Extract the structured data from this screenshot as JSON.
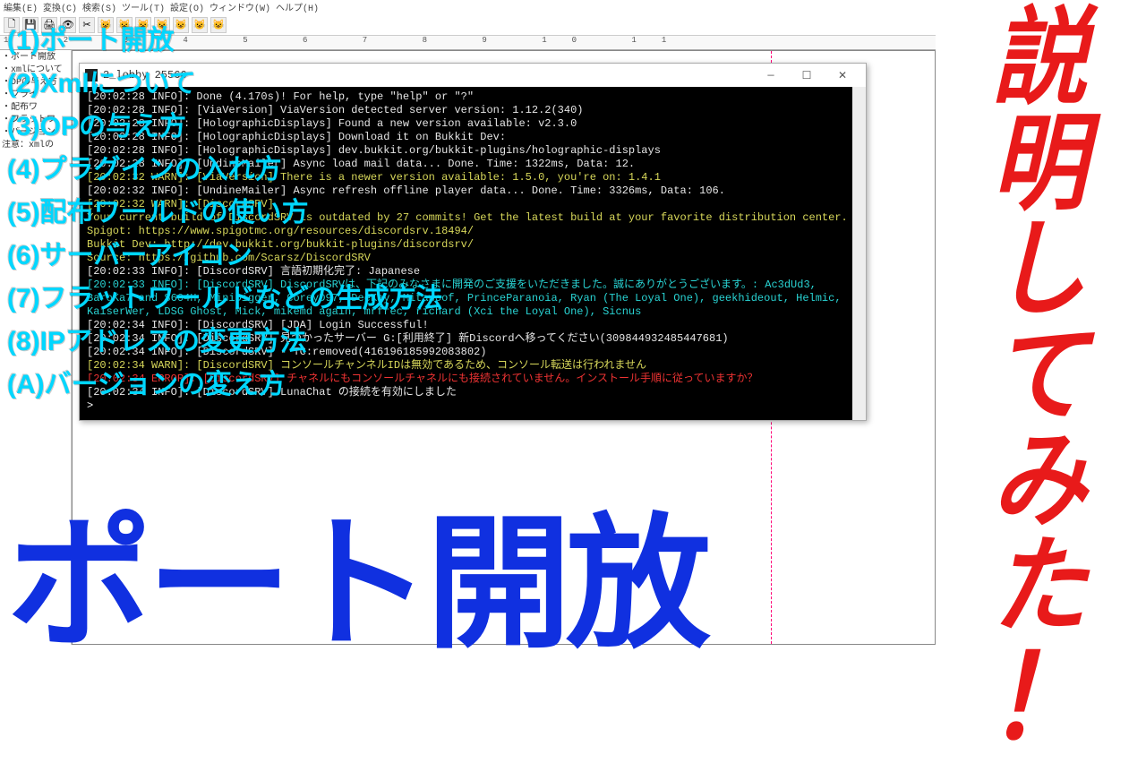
{
  "editor": {
    "menubar": "編集(E)  変換(C)  検索(S)  ツール(T)  設定(O)  ウィンドウ(W)  ヘルプ(H)",
    "ruler": "1 2 3 4 5 6 7 8 9 10 11",
    "outline": [
      "・ポート開放",
      "・xmlについて",
      "・OPの与え方",
      "・プライ",
      "・配布ワ",
      "・フラットワ",
      "・バージョン",
      "注意：xmlの"
    ]
  },
  "console": {
    "title": "2_lobby 25566",
    "lines": [
      {
        "cls": "c-white",
        "text": "[20:02:28 INFO]: Done (4.170s)! For help, type \"help\" or \"?\""
      },
      {
        "cls": "c-white",
        "text": "[20:02:28 INFO]: [ViaVersion] ViaVersion detected server version: 1.12.2(340)"
      },
      {
        "cls": "c-white",
        "text": "[20:02:28 INFO]: [HolographicDisplays] Found a new version available: v2.3.0"
      },
      {
        "cls": "c-white",
        "text": "[20:02:28 INFO]: [HolographicDisplays] Download it on Bukkit Dev:"
      },
      {
        "cls": "c-white",
        "text": "[20:02:28 INFO]: [HolographicDisplays] dev.bukkit.org/bukkit-plugins/holographic-displays"
      },
      {
        "cls": "c-white",
        "text": "[20:02:28 INFO]: [UndineMailer] Async load mail data... Done. Time: 1322ms, Data: 12."
      },
      {
        "cls": "c-yellow",
        "text": "[20:02:32 WARN]: [ViaVersion] There is a newer version available: 1.5.0, you're on: 1.4.1"
      },
      {
        "cls": "c-white",
        "text": "[20:02:32 INFO]: [UndineMailer] Async refresh offline player data... Done. Time: 3326ms, Data: 106."
      },
      {
        "cls": "c-yellow",
        "text": "[20:02:32 WARN]: [DiscordSRV]"
      },
      {
        "cls": "c-yellow",
        "text": ""
      },
      {
        "cls": "c-yellow",
        "text": "Your current build of DiscordSRV is outdated by 27 commits! Get the latest build at your favorite distribution center."
      },
      {
        "cls": "c-yellow",
        "text": "Spigot: https://www.spigotmc.org/resources/discordsrv.18494/"
      },
      {
        "cls": "c-yellow",
        "text": "Bukkit Dev: http://dev.bukkit.org/bukkit-plugins/discordsrv/"
      },
      {
        "cls": "c-yellow",
        "text": "Source: https://github.com/Scarsz/DiscordSRV"
      },
      {
        "cls": "c-yellow",
        "text": ""
      },
      {
        "cls": "c-white",
        "text": "[20:02:33 INFO]: [DiscordSRV] 言語初期化完了: Japanese"
      },
      {
        "cls": "c-cyan",
        "text": "[20:02:33 INFO]: [DiscordSRV] DiscordSRVは、下記のみなさまに開発のご支援をいただきました。誠にありがとうございます。: Ac3dUd3, BaroKa7 and S604H, MiniDigger, CoreyD97, DeeKay, Mitawoof, PrinceParanoia, Ryan (The Loyal One), geekhideout, Helmic, KaiserWer, LDSG Ghost, Mick, mikemd again, mrfrec, richard (Xci the Loyal One), Sicnus"
      },
      {
        "cls": "c-white",
        "text": "[20:02:34 INFO]: [DiscordSRV] [JDA] Login Successful!"
      },
      {
        "cls": "c-white",
        "text": "[20:02:34 INFO]: [DiscordSRV] 見つかったサーバー G:[利用終了] 新Discordへ移ってください(309844932485447681)"
      },
      {
        "cls": "c-white",
        "text": "[20:02:34 INFO]: [DiscordSRV] - TC:removed(416196185992083802)"
      },
      {
        "cls": "c-yellow",
        "text": "[20:02:34 WARN]: [DiscordSRV] コンソールチャンネルIDは無効であるため、コンソール転送は行われません"
      },
      {
        "cls": "c-red",
        "text": "[20:02:34 ERROR]: [DiscordSRV] チャネルにもコンソールチャネルにも接続されていません。インストール手順に従っていますか？"
      },
      {
        "cls": "c-white",
        "text": "[20:02:34 INFO]: [DiscordSRV] LunaChat の接続を有効にしました"
      },
      {
        "cls": "c-prompt",
        "text": ">"
      }
    ]
  },
  "cyan_list": [
    "(1)ポート開放",
    "(2)Xmlについて",
    "(3)OPの与え方",
    "(4)プラグインの入れ方",
    "(5)配布ワールドの使い方",
    "(6)サーバーアイコン",
    "(7)フラットワールドなどの生成方法",
    "(8)IPアドレスの変更方法",
    "(A)バージョンの変え方"
  ],
  "big_blue": "ポート開放",
  "red_vertical": [
    "説",
    "明",
    "し",
    "て",
    "み",
    "た",
    "！"
  ]
}
